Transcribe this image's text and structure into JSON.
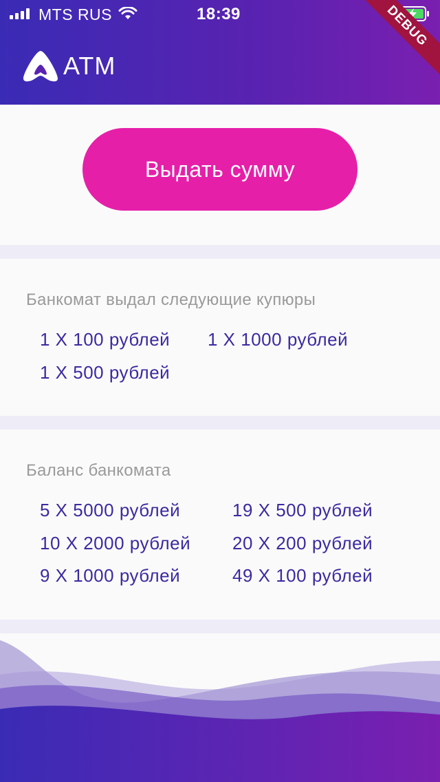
{
  "status_bar": {
    "carrier": "MTS RUS",
    "time": "18:39",
    "debug_label": "DEBUG",
    "icons": [
      "signal-icon",
      "wifi-icon",
      "battery-charging-icon"
    ]
  },
  "header": {
    "app_title": "ATM",
    "logo_icon": "atm-logo-icon"
  },
  "dispense": {
    "button_label": "Выдать сумму"
  },
  "issued": {
    "title": "Банкомат выдал следующие купюры",
    "items": [
      "1 X 100 рублей",
      "1 X 1000 рублей",
      "1 X 500 рублей"
    ]
  },
  "balance": {
    "title": "Баланс банкомата",
    "items": [
      "5 X 5000 рублей",
      "19 X 500 рублей",
      "10 X 2000 рублей",
      "20 X 200 рублей",
      "9 X 1000 рублей",
      "49 X 100 рублей"
    ]
  },
  "colors": {
    "header_gradient_start": "#3a2bb5",
    "header_gradient_end": "#7a1fb0",
    "accent_button": "#e61fa9",
    "note_text": "#3b2aa0",
    "section_title": "#9a9a9a",
    "debug_ribbon": "#a0143f"
  }
}
